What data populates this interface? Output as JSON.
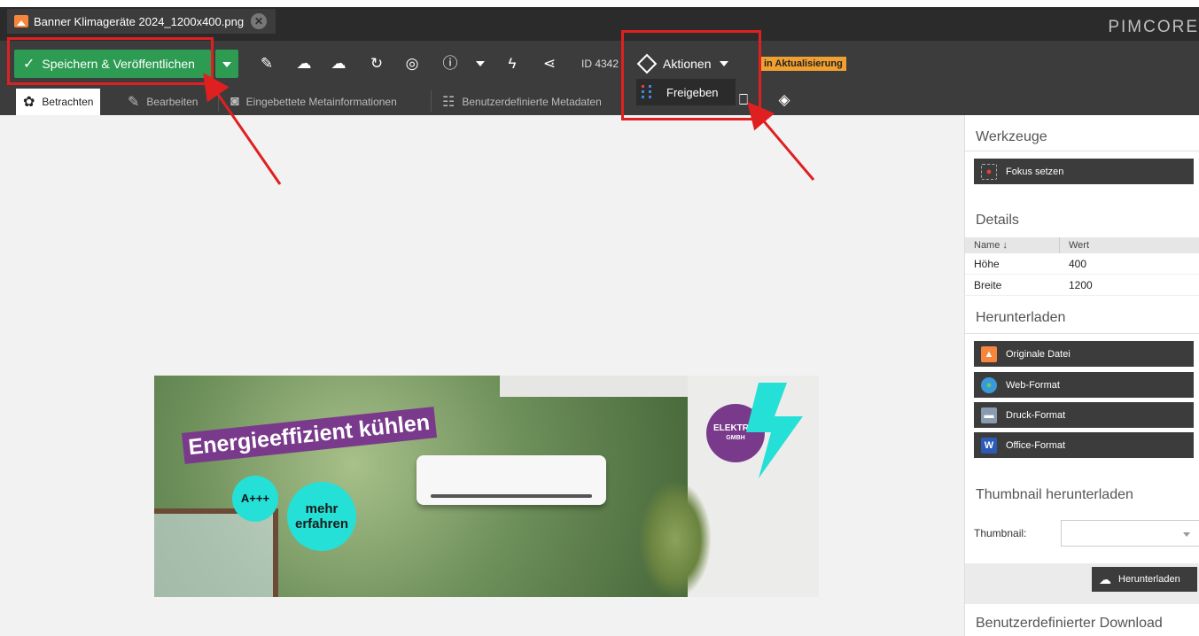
{
  "tab": {
    "title": "Banner Klimageräte 2024_1200x400.png",
    "icon": "image-icon"
  },
  "brand": "PIMCORE",
  "toolbar": {
    "save_label": "Speichern & Veröffentlichen",
    "id_label": "ID 4342",
    "actions_label": "Aktionen",
    "status_badge": "in Aktualisierung"
  },
  "subtabs": [
    {
      "label": "Betrachten",
      "icon": "eye-icon"
    },
    {
      "label": "Bearbeiten",
      "icon": "pencil-icon"
    },
    {
      "label": "Eingebettete Metainformationen",
      "icon": "camera-icon"
    },
    {
      "label": "Benutzerdefinierte Metadaten",
      "icon": "metadata-icon"
    }
  ],
  "dropdown": {
    "item": "Freigeben"
  },
  "banner": {
    "headline": "Energieeffizient kühlen",
    "badge_a": "A+++",
    "badge_more_1": "mehr",
    "badge_more_2": "erfahren",
    "logo_1": "ELEKTRIK",
    "logo_2": "GMBH"
  },
  "panel": {
    "tools_title": "Werkzeuge",
    "focus_button": "Fokus setzen",
    "details_title": "Details",
    "col_name": "Name",
    "col_value": "Wert",
    "rows": [
      {
        "name": "Höhe",
        "value": "400"
      },
      {
        "name": "Breite",
        "value": "1200"
      }
    ],
    "download_title": "Herunterladen",
    "downloads": [
      "Originale Datei",
      "Web-Format",
      "Druck-Format",
      "Office-Format"
    ],
    "thumb_title": "Thumbnail herunterladen",
    "thumb_label": "Thumbnail:",
    "thumb_button": "Herunterladen",
    "custom_title": "Benutzerdefinierter Download"
  },
  "colors": {
    "save_green": "#2d9b52",
    "annotation_red": "#e02020",
    "badge_orange": "#f0a030",
    "banner_purple": "#7a3a8c",
    "banner_cyan": "#24e0d6"
  }
}
